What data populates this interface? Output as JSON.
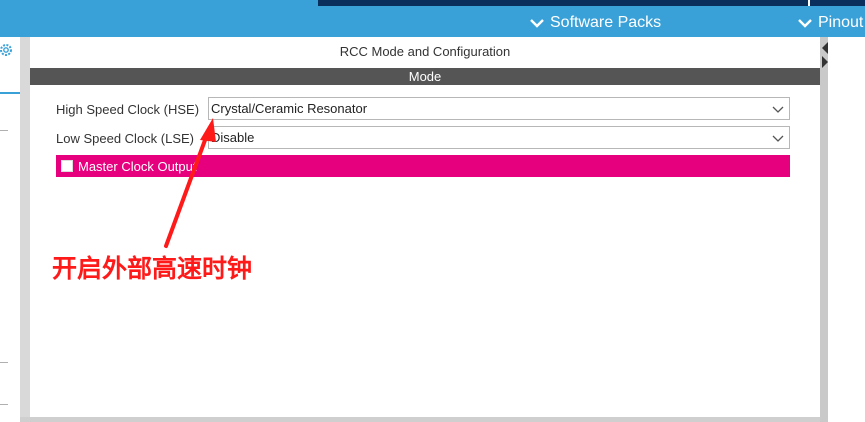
{
  "menubar": {
    "software_packs": "Software Packs",
    "pinout": "Pinout"
  },
  "panel": {
    "title": "RCC Mode and Configuration",
    "mode_header": "Mode",
    "hse": {
      "label": "High Speed Clock (HSE)",
      "value": "Crystal/Ceramic Resonator"
    },
    "lse": {
      "label": "Low Speed Clock (LSE)",
      "value": "Disable"
    },
    "master_clock_output": {
      "label": "Master Clock Output",
      "checked": false
    }
  },
  "annotation": {
    "text": "开启外部高速时钟",
    "color": "#ff1a1a"
  },
  "colors": {
    "menubar": "#3aa1d8",
    "mode_header": "#555555",
    "highlight_row": "#e6007e"
  }
}
